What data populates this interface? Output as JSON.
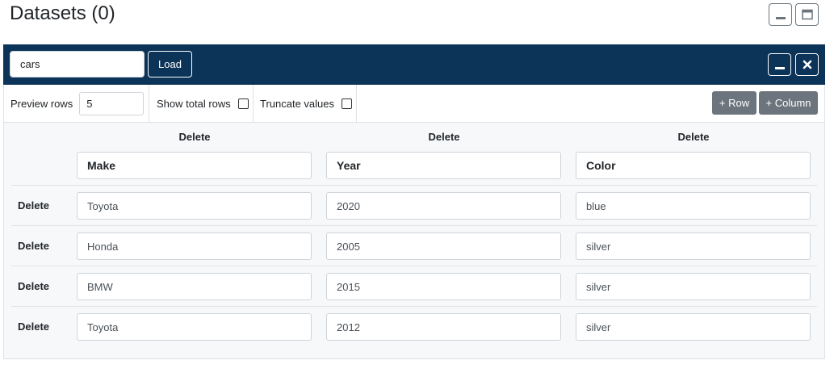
{
  "page": {
    "title": "Datasets (0)"
  },
  "icons": {
    "minimize": "minimize-icon",
    "maximize": "window-maximize-icon",
    "close": "close-icon"
  },
  "colors": {
    "header_bg": "#0c3358",
    "secondary_button": "#6c757d"
  },
  "dataset": {
    "name_value": "cars",
    "load_label": "Load"
  },
  "toolbar": {
    "preview_rows_label": "Preview rows",
    "preview_rows_value": "5",
    "show_total_rows_label": "Show total rows",
    "truncate_values_label": "Truncate values",
    "add_row_label": "+ Row",
    "add_column_label": "+ Column"
  },
  "table": {
    "delete_label": "Delete",
    "columns": [
      "Make",
      "Year",
      "Color"
    ],
    "rows": [
      [
        "Toyota",
        "2020",
        "blue"
      ],
      [
        "Honda",
        "2005",
        "silver"
      ],
      [
        "BMW",
        "2015",
        "silver"
      ],
      [
        "Toyota",
        "2012",
        "silver"
      ]
    ]
  }
}
